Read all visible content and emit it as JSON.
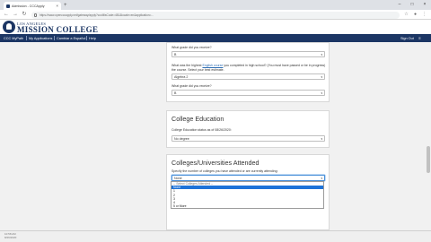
{
  "browser": {
    "tab_title": "Admission - CCCApply",
    "url": "https://www.opencccapply.net/gateway/apply?cccMisCode=481&locale=en&application=..."
  },
  "site": {
    "logo_small": "LOS ANGELES",
    "logo_big": "MISSION COLLEGE",
    "nav": {
      "items": [
        "CCC MyPath",
        "My Applications",
        "Cambiar a Español",
        "Help"
      ],
      "right": "Sign Out"
    }
  },
  "section_hs": {
    "q_grade1": "What grade did you receive?",
    "grade1_value": "B",
    "q_math_prefix": "What was the highest",
    "q_math_link": "English course",
    "q_math_suffix": "you completed in high school? (You must have passed or be in progress)",
    "q_math_line2": "the course. Select your best estimate.",
    "math_value": "Algebra 2",
    "q_grade2": "What grade did you receive?",
    "grade2_value": "B"
  },
  "college_education": {
    "title": "College Education",
    "question": "College Education status as of 08/26/2020:",
    "value": "No degree"
  },
  "colleges_attended": {
    "title": "Colleges/Universities Attended",
    "question": "Specify the number of colleges you have attended or are currently attending:",
    "value": "None",
    "options": [
      "-- Select Colleges Attended --",
      "None",
      "1",
      "2",
      "3",
      "4",
      "5 or More"
    ],
    "selected_index": 1
  },
  "taskbar": {
    "line1": "10:58 AM",
    "line2": "8/26/2020"
  }
}
